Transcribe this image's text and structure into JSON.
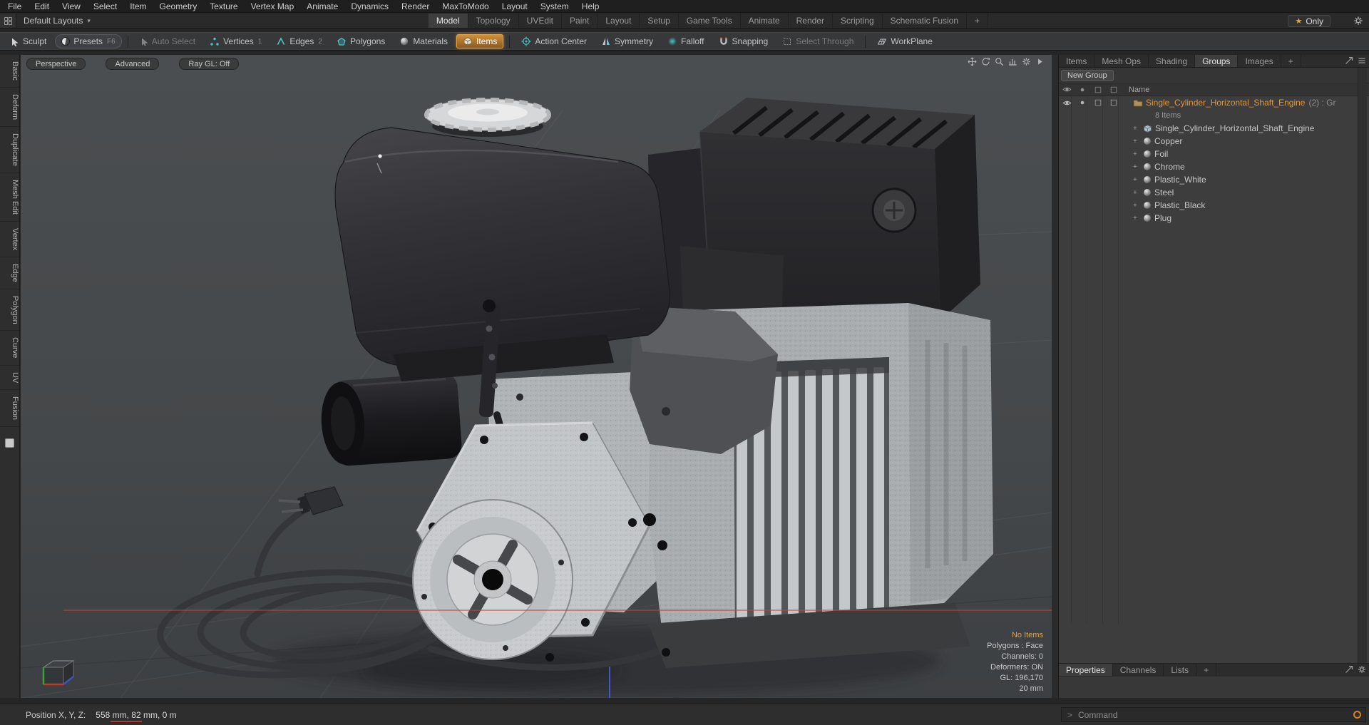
{
  "colors": {
    "accent_orange": "#e0973f",
    "selection_teal": "#49c4c9",
    "axis_red": "#c0443a",
    "axis_green": "#3aa03a",
    "axis_blue": "#4a5ad0",
    "viewport_bg": "#46494b"
  },
  "menubar": {
    "items": [
      "File",
      "Edit",
      "View",
      "Select",
      "Item",
      "Geometry",
      "Texture",
      "Vertex Map",
      "Animate",
      "Dynamics",
      "Render",
      "MaxToModo",
      "Layout",
      "System",
      "Help"
    ]
  },
  "layout_bar": {
    "switcher": "Default Layouts",
    "tabs": [
      "Model",
      "Topology",
      "UVEdit",
      "Paint",
      "Layout",
      "Setup",
      "Game Tools",
      "Animate",
      "Render",
      "Scripting",
      "Schematic Fusion",
      "+"
    ],
    "only_label": "Only"
  },
  "toolbar": {
    "items": [
      {
        "label": "Sculpt"
      },
      {
        "label": "Presets",
        "key": "F6"
      },
      {
        "label": "Auto Select"
      },
      {
        "label": "Vertices",
        "key": "1"
      },
      {
        "label": "Edges",
        "key": "2"
      },
      {
        "label": "Polygons"
      },
      {
        "label": "Materials"
      },
      {
        "label": "Items"
      },
      {
        "label": "Action Center"
      },
      {
        "label": "Symmetry"
      },
      {
        "label": "Falloff"
      },
      {
        "label": "Snapping"
      },
      {
        "label": "Select Through"
      },
      {
        "label": "WorkPlane"
      }
    ]
  },
  "left_tabs": {
    "items": [
      "Basic",
      "Deform",
      "Duplicate",
      "Mesh Edit",
      "Vertex",
      "Edge",
      "Polygon",
      "Curve",
      "UV",
      "Fusion"
    ]
  },
  "viewport": {
    "view_buttons": [
      "Perspective",
      "Advanced",
      "Ray GL: Off"
    ],
    "info": {
      "no_items": "No Items",
      "polygons": "Polygons : Face",
      "channels": "Channels: 0",
      "deformers": "Deformers: ON",
      "gl": "GL: 196,170",
      "grid_size": "20 mm"
    }
  },
  "right_panel": {
    "tabs": [
      "Items",
      "Mesh Ops",
      "Shading",
      "Groups",
      "Images",
      "+"
    ],
    "new_group_label": "New Group",
    "name_header": "Name",
    "group": {
      "label": "Single_Cylinder_Horizontal_Shaft_Engine",
      "suffix": "(2) : Gr",
      "items_count": "8 Items",
      "children": [
        "Single_Cylinder_Horizontal_Shaft_Engine",
        "Copper",
        "Foil",
        "Chrome",
        "Plastic_White",
        "Steel",
        "Plastic_Black",
        "Plug"
      ]
    },
    "bottom_tabs": [
      "Properties",
      "Channels",
      "Lists",
      "+"
    ]
  },
  "status_bar": {
    "label": "Position X, Y, Z:",
    "value": "558 mm, 82 mm, 0 m"
  },
  "command_bar": {
    "prompt": ">",
    "placeholder": "Command"
  },
  "icons": {
    "star": "★",
    "dropdown_arrow": "▾",
    "expander": "+"
  }
}
